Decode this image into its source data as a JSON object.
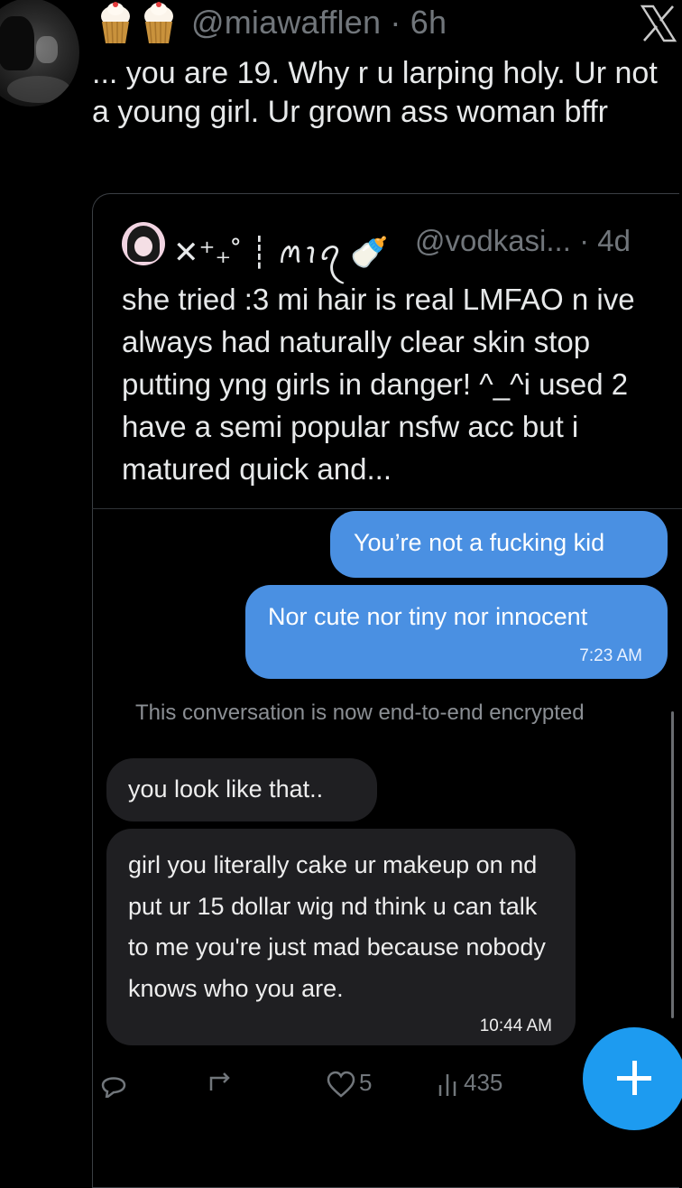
{
  "tweet": {
    "emojis": [
      "🧁",
      "🧁"
    ],
    "handle_time": "@miawafflen · 6h",
    "text": "... you are 19. Why r u larping holy. Ur not a young girl. Ur grown ass woman bffr"
  },
  "quoted": {
    "display_name": "✕⁺₊˚ ┊ ꪔꪱꪖ 🍼",
    "handle_time": "@vodkasi... · 4d",
    "text": "she tried :3 mi hair is real LMFAO n ive always had naturally clear skin stop putting yng girls in danger! ^_^i used 2 have a semi popular nsfw acc but i matured quick and..."
  },
  "chat": {
    "sent": [
      {
        "text": "You’re not a fucking kid"
      },
      {
        "text": "Nor cute nor tiny nor innocent",
        "time": "7:23 AM"
      }
    ],
    "notice": "This conversation is now end-to-end encrypted",
    "received": [
      {
        "text": "you look like that.."
      },
      {
        "text": "girl you literally cake ur makeup on nd put ur 15 dollar wig nd think u can talk to me you're just mad because nobody knows who you are.",
        "time": "10:44 AM"
      }
    ]
  },
  "actions": {
    "likes": "5",
    "views": "435"
  },
  "icons": {
    "close": "x-logo-icon",
    "fab": "compose-plus-icon"
  },
  "colors": {
    "accent": "#1d9bf0",
    "bubble_sent": "#4a90e2",
    "bubble_received": "#1f1f22",
    "muted": "#71767b"
  }
}
